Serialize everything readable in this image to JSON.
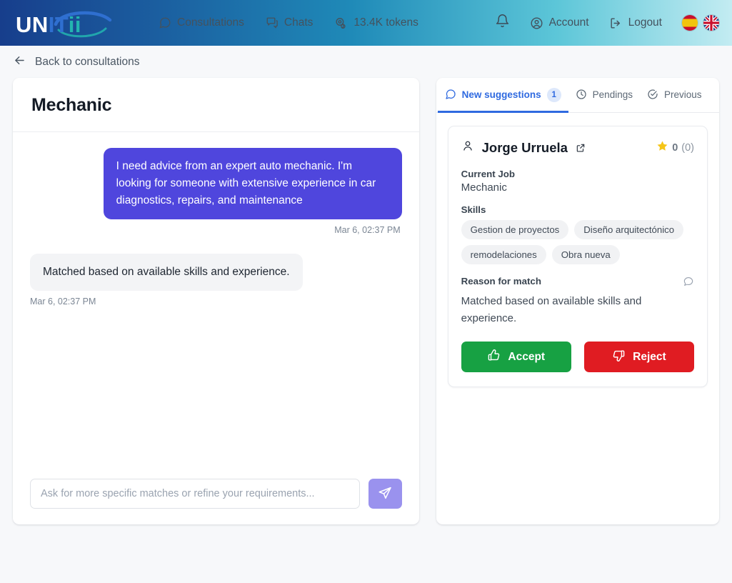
{
  "brand": {
    "logo_part_1": "UN",
    "logo_part_2": "IT",
    "logo_part_3": "ii",
    "colors": {
      "white": "#ffffff",
      "blue": "#2f6fd0",
      "teal": "#23b5b0",
      "accent_purple": "#4f46dd",
      "tab_active": "#2f6ae0",
      "accept_green": "#17a143",
      "reject_red": "#e01c22",
      "star_yellow": "#f5c518"
    }
  },
  "topnav": {
    "items": [
      {
        "label": "Consultations",
        "icon": "message-square-icon"
      },
      {
        "label": "Chats",
        "icon": "chats-icon"
      },
      {
        "label": "13.4K tokens",
        "icon": "tokens-icon"
      }
    ],
    "notifications_icon": "bell-icon",
    "account": {
      "label": "Account",
      "icon": "user-circle-icon"
    },
    "logout": {
      "label": "Logout",
      "icon": "logout-icon"
    },
    "languages": [
      {
        "name": "spanish-flag",
        "code": "ES"
      },
      {
        "name": "uk-flag",
        "code": "EN"
      }
    ]
  },
  "back": {
    "label": "Back to consultations",
    "icon": "arrow-left-icon"
  },
  "chat": {
    "title": "Mechanic",
    "messages": [
      {
        "direction": "out",
        "text": "I need advice from an expert auto mechanic. I'm looking for someone with extensive experience in car diagnostics, repairs, and maintenance",
        "time": "Mar 6, 02:37 PM"
      },
      {
        "direction": "in",
        "text": "Matched based on available skills and experience.",
        "time": "Mar 6, 02:37 PM"
      }
    ],
    "input": {
      "value": "",
      "placeholder": "Ask for more specific matches or refine your requirements..."
    },
    "send_button": {
      "label": "",
      "icon": "send-icon"
    }
  },
  "suggestions": {
    "tabs": [
      {
        "label": "New suggestions",
        "icon": "message-square-icon",
        "badge": "1",
        "active": true
      },
      {
        "label": "Pendings",
        "icon": "clock-icon",
        "badge": "",
        "active": false
      },
      {
        "label": "Previous",
        "icon": "check-circle-icon",
        "badge": "",
        "active": false
      }
    ],
    "card": {
      "person_icon": "user-icon",
      "name": "Jorge Urruela",
      "external_link_icon": "external-link-icon",
      "rating": {
        "icon": "star-icon",
        "score": "0",
        "count": "(0)"
      },
      "current_job_label": "Current Job",
      "current_job_value": "Mechanic",
      "skills_label": "Skills",
      "skills": [
        "Gestion de proyectos",
        "Diseño arquitectónico",
        "remodelaciones",
        "Obra nueva"
      ],
      "reason_label": "Reason for match",
      "reason_icon": "chat-bubble-icon",
      "reason_text": "Matched based on available skills and experience.",
      "accept_button": {
        "label": "Accept",
        "icon": "thumbs-up-icon"
      },
      "reject_button": {
        "label": "Reject",
        "icon": "thumbs-down-icon"
      }
    }
  }
}
